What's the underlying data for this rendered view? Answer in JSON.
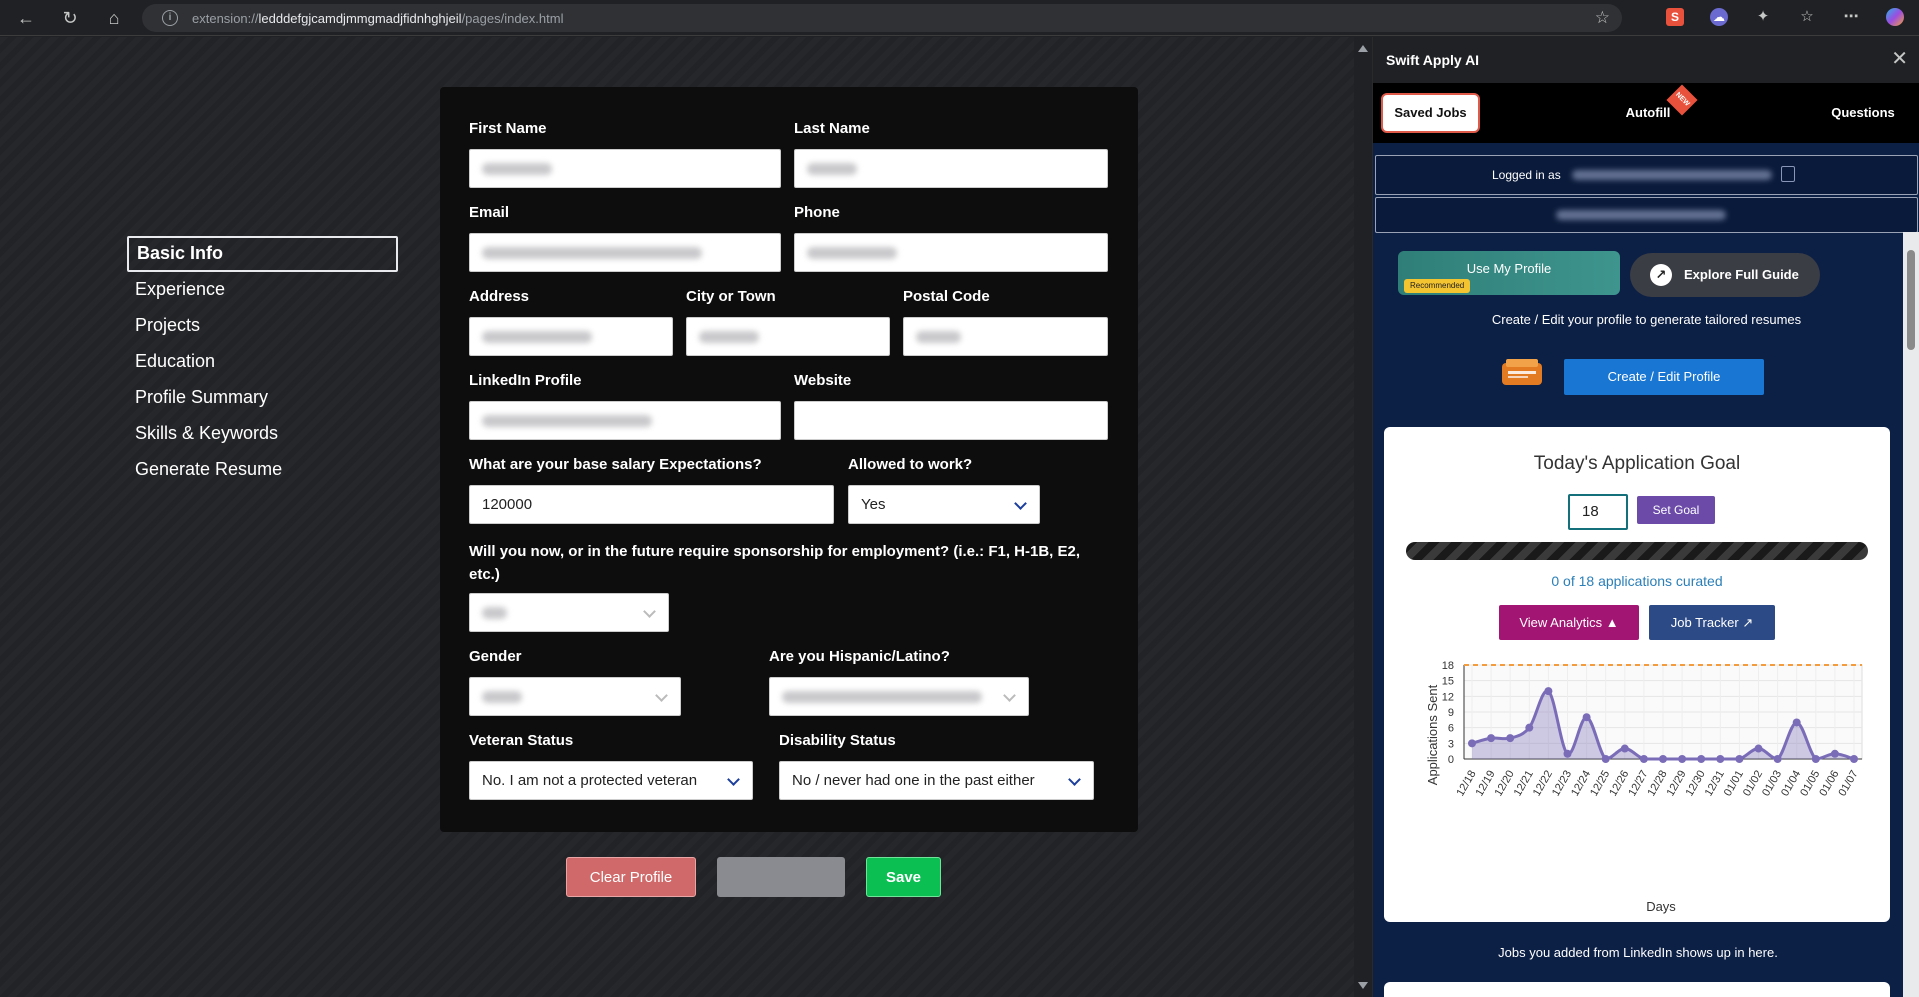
{
  "browser": {
    "url_scheme": "extension://",
    "url_host": "ledddefgjcamdjmmgmadjfidnhghjeil",
    "url_path": "/pages/index.html"
  },
  "nav": {
    "items": [
      "Basic Info",
      "Experience",
      "Projects",
      "Education",
      "Profile Summary",
      "Skills & Keywords",
      "Generate Resume"
    ]
  },
  "form": {
    "first_name_label": "First Name",
    "last_name_label": "Last Name",
    "email_label": "Email",
    "phone_label": "Phone",
    "address_label": "Address",
    "city_label": "City or Town",
    "postal_label": "Postal Code",
    "linkedin_label": "LinkedIn Profile",
    "website_label": "Website",
    "salary_label": "What are your base salary Expectations?",
    "salary_value": "120000",
    "allowed_label": "Allowed to work?",
    "allowed_value": "Yes",
    "sponsorship_label": "Will you now, or in the future require sponsorship for employment? (i.e.: F1, H-1B, E2, etc.)",
    "gender_label": "Gender",
    "hispanic_label": "Are you Hispanic/Latino?",
    "veteran_label": "Veteran Status",
    "veteran_value": "No. I am not a protected veteran",
    "disability_label": "Disability Status",
    "disability_value": "No / never had one in the past either"
  },
  "buttons": {
    "clear_profile": "Clear Profile",
    "save": "Save"
  },
  "panel": {
    "title": "Swift Apply AI",
    "tabs": [
      "Saved Jobs",
      "Autofill",
      "Questions"
    ],
    "autofill_badge": "NEW",
    "logged_in_label": "Logged in as",
    "use_profile": "Use My Profile",
    "recommended": "Recommended",
    "explore": "Explore Full Guide",
    "profile_sub": "Create / Edit your profile to generate tailored resumes",
    "create_edit": "Create / Edit Profile",
    "goal_title": "Today's Application Goal",
    "goal_value": "18",
    "set_goal": "Set Goal",
    "goal_count": "0 of 18 applications curated",
    "goal_progress": 0,
    "view_analytics": "View Analytics",
    "job_tracker": "Job Tracker",
    "footer_text": "Jobs you added from LinkedIn shows up in here."
  },
  "chart_data": {
    "type": "line",
    "xlabel": "Days",
    "ylabel": "Applications Sent",
    "ylim": [
      0,
      18
    ],
    "yticks": [
      0,
      3,
      6,
      9,
      12,
      15,
      18
    ],
    "goal_line": 18,
    "goal_color": "#f39c3d",
    "line_color": "#7b6cb8",
    "x": [
      "12/18",
      "12/19",
      "12/20",
      "12/21",
      "12/22",
      "12/23",
      "12/24",
      "12/25",
      "12/26",
      "12/27",
      "12/28",
      "12/29",
      "12/30",
      "12/31",
      "01/01",
      "01/02",
      "01/03",
      "01/04",
      "01/05",
      "01/06",
      "01/07"
    ],
    "values": [
      3,
      4,
      4,
      6,
      13,
      1,
      8,
      0,
      2,
      0,
      0,
      0,
      0,
      0,
      0,
      2,
      0,
      7,
      0,
      1,
      0
    ]
  }
}
